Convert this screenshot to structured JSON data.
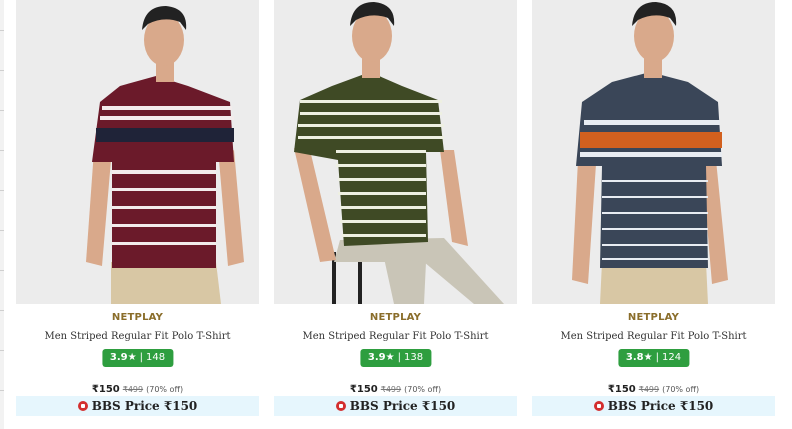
{
  "products": [
    {
      "brand": "NETPLAY",
      "title": "Men Striped Regular Fit Polo T-Shirt",
      "rating": "3.9",
      "rating_star": "★",
      "rating_count": "148",
      "price": "₹150",
      "mrp": "₹499",
      "discount": "(70% off)",
      "bbs_label": "BBS Price ₹150",
      "shirt_color": "#6b1a2a",
      "stripe_color": "#f3ecec",
      "band_color": "#1f2338",
      "image_icon": "product-photo-maroon-polo"
    },
    {
      "brand": "NETPLAY",
      "title": "Men Striped Regular Fit Polo T-Shirt",
      "rating": "3.9",
      "rating_star": "★",
      "rating_count": "138",
      "price": "₹150",
      "mrp": "₹499",
      "discount": "(70% off)",
      "bbs_label": "BBS Price ₹150",
      "shirt_color": "#3f4a25",
      "stripe_color": "#eef0e2",
      "band_color": "#3f4a25",
      "image_icon": "product-photo-olive-polo"
    },
    {
      "brand": "NETPLAY",
      "title": "Men Striped Regular Fit Polo T-Shirt",
      "rating": "3.8",
      "rating_star": "★",
      "rating_count": "124",
      "price": "₹150",
      "mrp": "₹499",
      "discount": "(70% off)",
      "bbs_label": "BBS Price ₹150",
      "shirt_color": "#3a4658",
      "stripe_color": "#e8ecf2",
      "band_color": "#d2601e",
      "image_icon": "product-photo-navy-polo"
    }
  ],
  "colors": {
    "rating_bg": "#2e9e3f",
    "brand_text": "#8a6d2a",
    "bbs_bg": "#e6f6fd"
  }
}
